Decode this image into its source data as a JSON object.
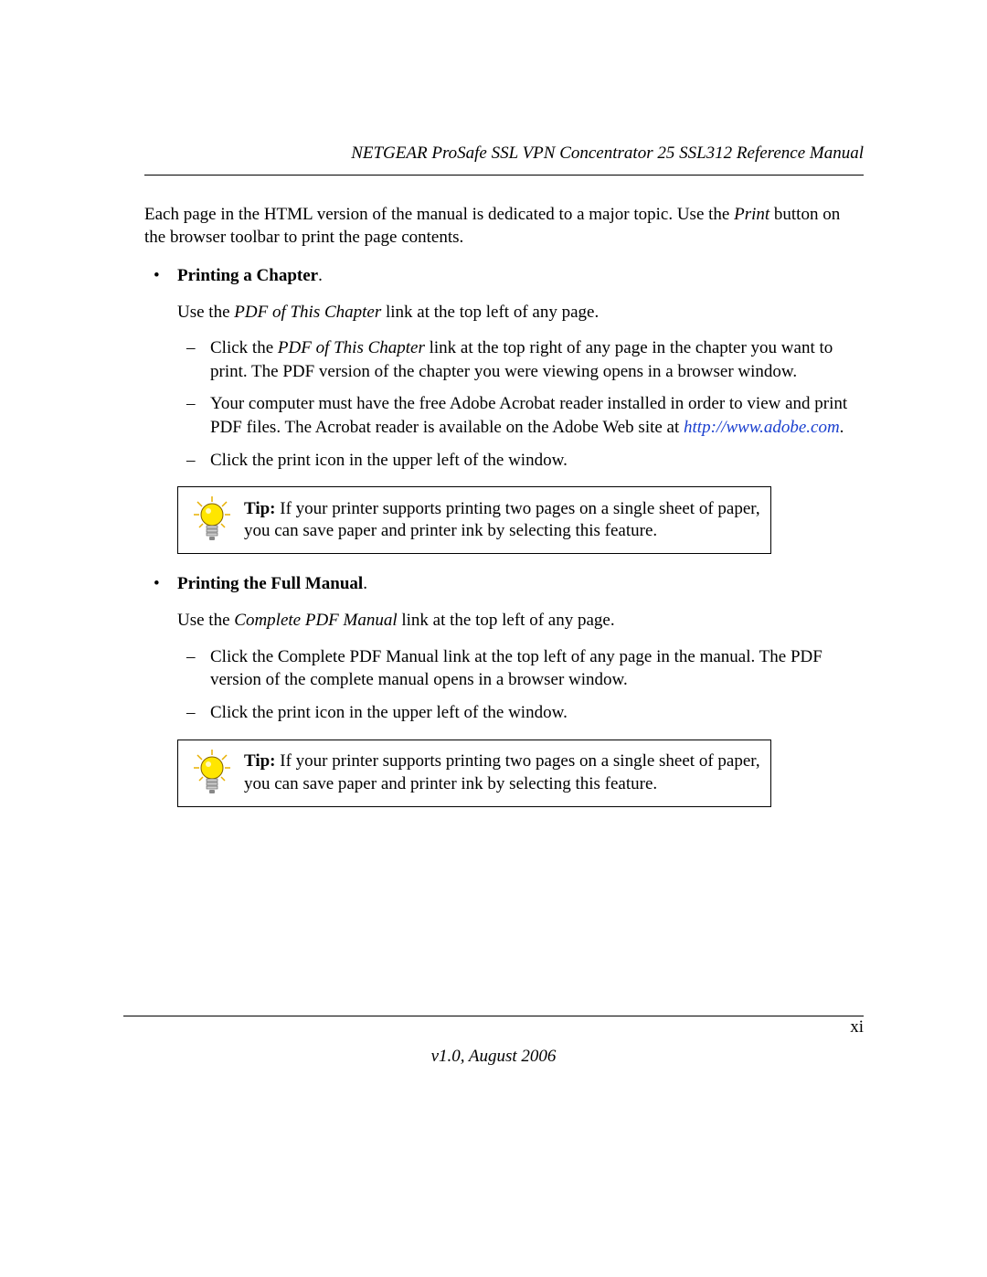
{
  "header": {
    "running_title": "NETGEAR ProSafe SSL VPN Concentrator 25 SSL312 Reference Manual"
  },
  "intro": {
    "pre": "Each page in the HTML version of the manual is dedicated to a major topic. Use the ",
    "ital": "Print",
    "post": " button on the browser toolbar to print the page contents."
  },
  "sections": [
    {
      "title": "Printing a Chapter",
      "lead_pre": "Use the ",
      "lead_ital": "PDF of This Chapter",
      "lead_post": " link at the top left of any page.",
      "items": [
        {
          "pre": "Click the ",
          "ital": "PDF of This Chapter",
          "post": " link at the top right of any page in the chapter you want to print. The PDF version of the chapter you were viewing opens in a browser window."
        },
        {
          "pre": "Your computer must have the free Adobe Acrobat reader installed in order to view and print PDF files. The Acrobat reader is available on the Adobe Web site at ",
          "link_text": "http://www.adobe.com",
          "link_href": "http://www.adobe.com",
          "post": "."
        },
        {
          "pre": "Click the print icon in the upper left of the window."
        }
      ],
      "tip": {
        "label": "Tip:",
        "text": " If your printer supports printing two pages on a single sheet of paper, you can save paper and printer ink by selecting this feature."
      }
    },
    {
      "title": "Printing the Full Manual",
      "lead_pre": "Use the ",
      "lead_ital": "Complete PDF Manual",
      "lead_post": " link at the top left of any page.",
      "items": [
        {
          "pre": "Click the Complete PDF Manual link at the top left of any page in the manual. The PDF version of the complete manual opens in a browser window."
        },
        {
          "pre": "Click the print icon in the upper left of the window."
        }
      ],
      "tip": {
        "label": "Tip:",
        "text": " If your printer supports printing two pages on a single sheet of paper, you can save paper and printer ink by selecting this feature."
      }
    }
  ],
  "footer": {
    "page_number": "xi",
    "version": "v1.0, August 2006"
  }
}
